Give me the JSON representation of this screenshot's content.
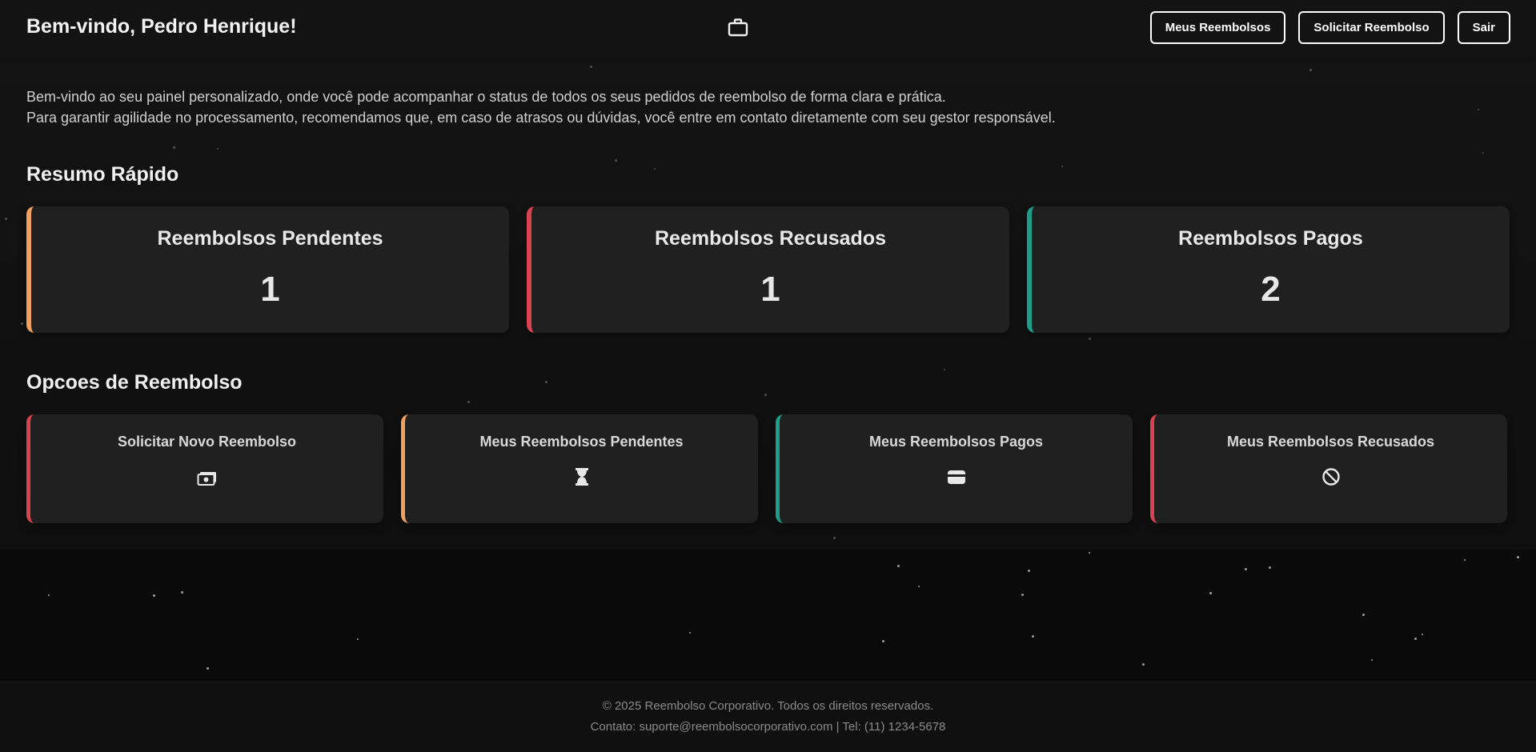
{
  "header": {
    "title": "Bem-vindo, Pedro Henrique!",
    "logo_icon": "briefcase-icon",
    "nav": [
      "Meus Reembolsos",
      "Solicitar Reembolso",
      "Sair"
    ]
  },
  "intro": {
    "line1": "Bem-vindo ao seu painel personalizado, onde você pode acompanhar o status de todos os seus pedidos de reembolso de forma clara e prática.",
    "line2": "Para garantir agilidade no processamento, recomendamos que, em caso de atrasos ou dúvidas, você entre em contato diretamente com seu gestor responsável."
  },
  "summary": {
    "title": "Resumo Rápido",
    "cards": [
      {
        "label": "Reembolsos Pendentes",
        "value": "1",
        "accent": "#f0a060"
      },
      {
        "label": "Reembolsos Recusados",
        "value": "1",
        "accent": "#d9434f"
      },
      {
        "label": "Reembolsos Pagos",
        "value": "2",
        "accent": "#1e9e8a"
      }
    ]
  },
  "options": {
    "title": "Opcoes de Reembolso",
    "cards": [
      {
        "label": "Solicitar Novo Reembolso",
        "icon": "money-bill-icon",
        "accent": "#d9434f"
      },
      {
        "label": "Meus Reembolsos Pendentes",
        "icon": "hourglass-icon",
        "accent": "#f0a060"
      },
      {
        "label": "Meus Reembolsos Pagos",
        "icon": "wallet-icon",
        "accent": "#1e9e8a"
      },
      {
        "label": "Meus Reembolsos Recusados",
        "icon": "ban-icon",
        "accent": "#d9434f"
      }
    ]
  },
  "footer": {
    "copyright": "© 2025 Reembolso Corporativo. Todos os direitos reservados.",
    "contact": "Contato: suporte@reembolsocorporativo.com | Tel: (11) 1234-5678"
  },
  "colors": {
    "background": "#0c0c0c",
    "card": "#202020",
    "pending": "#f0a060",
    "refused": "#d9434f",
    "paid": "#1e9e8a"
  }
}
